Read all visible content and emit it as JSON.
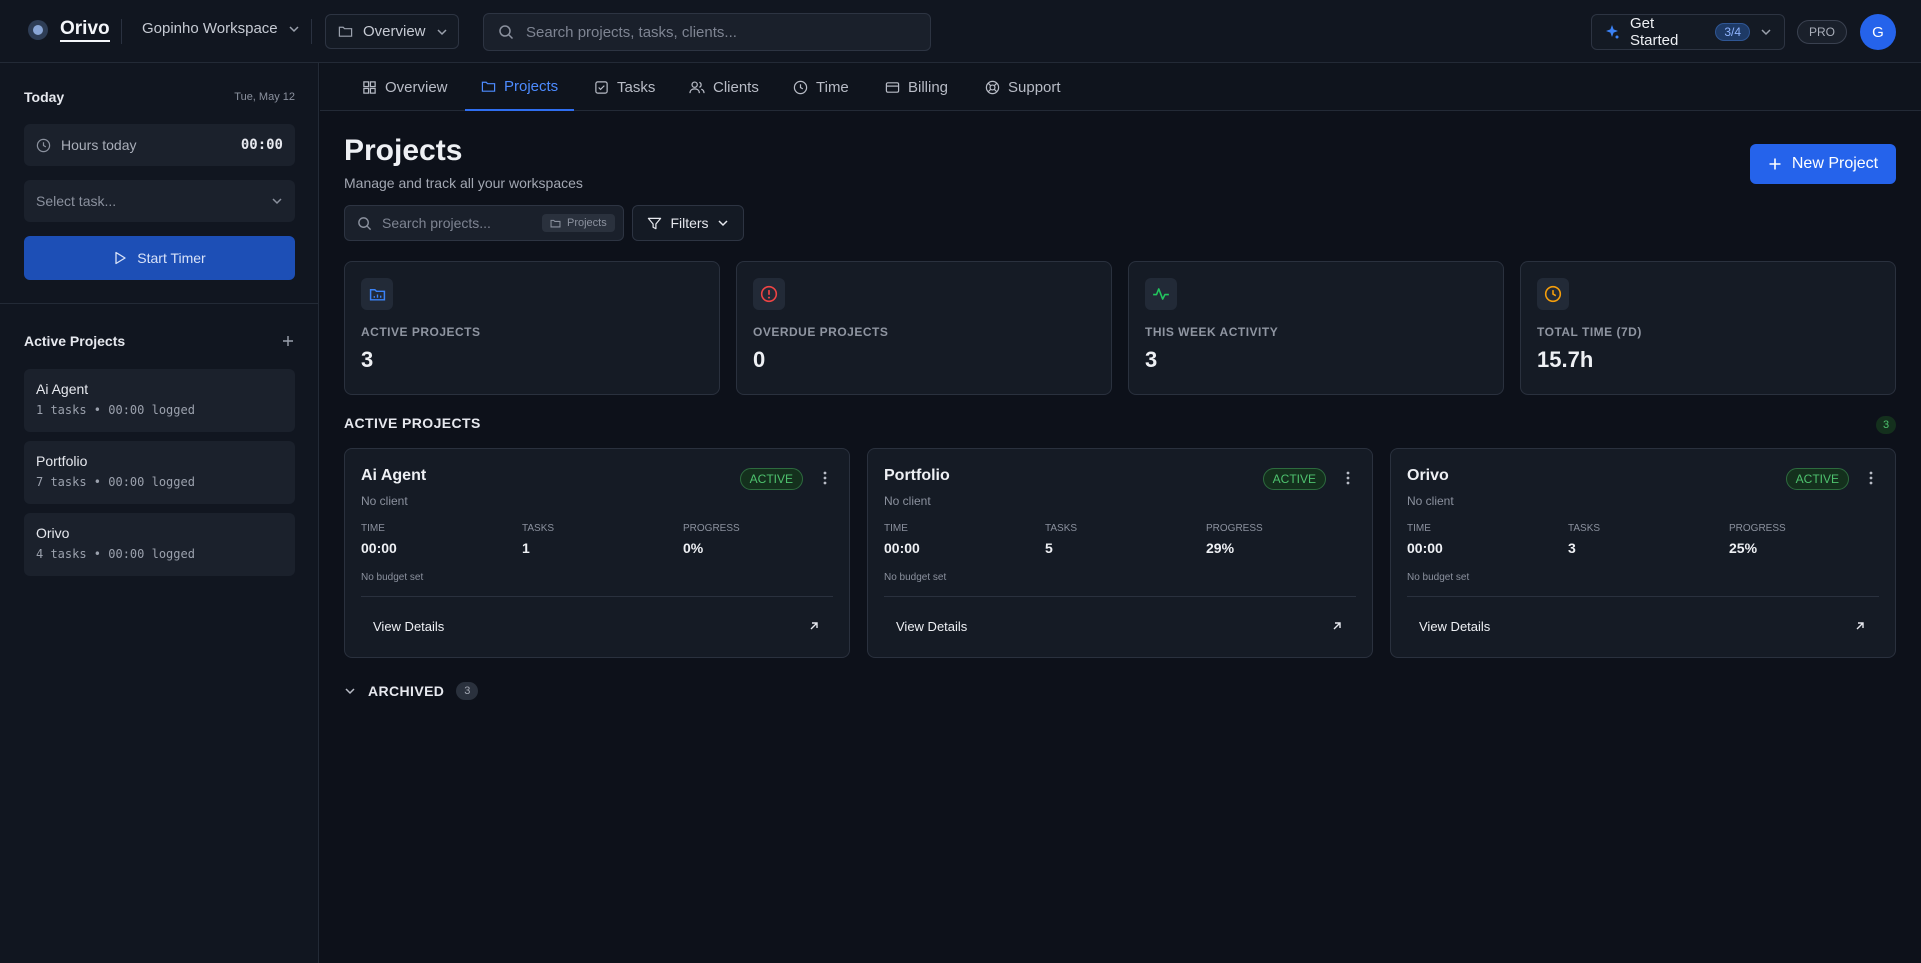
{
  "app": {
    "name": "Orivo",
    "workspace": "Gopinho Workspace",
    "view": "Overview"
  },
  "search": {
    "placeholder": "Search projects, tasks, clients..."
  },
  "get_started": {
    "label": "Get Started",
    "progress": "3/4"
  },
  "plan": "PRO",
  "user": {
    "initial": "G"
  },
  "sidebar": {
    "today": {
      "title": "Today",
      "date": "Tue, May 12"
    },
    "hours": {
      "label": "Hours today",
      "value": "00:00"
    },
    "task_select": {
      "placeholder": "Select task..."
    },
    "start_timer": "Start Timer",
    "active_projects": {
      "title": "Active Projects",
      "items": [
        {
          "name": "Ai Agent",
          "meta": "1 tasks • 00:00 logged"
        },
        {
          "name": "Portfolio",
          "meta": "7 tasks • 00:00 logged"
        },
        {
          "name": "Orivo",
          "meta": "4 tasks • 00:00 logged"
        }
      ]
    }
  },
  "tabs": [
    {
      "label": "Overview",
      "icon": "grid-icon",
      "active": false
    },
    {
      "label": "Projects",
      "icon": "folder-icon",
      "active": true
    },
    {
      "label": "Tasks",
      "icon": "checkbox-icon",
      "active": false
    },
    {
      "label": "Clients",
      "icon": "users-icon",
      "active": false
    },
    {
      "label": "Time",
      "icon": "clock-icon",
      "active": false
    },
    {
      "label": "Billing",
      "icon": "card-icon",
      "active": false
    },
    {
      "label": "Support",
      "icon": "lifebuoy-icon",
      "active": false
    }
  ],
  "page": {
    "title": "Projects",
    "subtitle": "Manage and track all your workspaces",
    "new_project": "New Project",
    "project_search": {
      "placeholder": "Search projects...",
      "scope": "Projects"
    },
    "filters": "Filters"
  },
  "stats": [
    {
      "label": "ACTIVE PROJECTS",
      "value": "3",
      "icon": "folder-icon",
      "color": "#3b82f6"
    },
    {
      "label": "OVERDUE PROJECTS",
      "value": "0",
      "icon": "alert-icon",
      "color": "#ef4444"
    },
    {
      "label": "THIS WEEK ACTIVITY",
      "value": "3",
      "icon": "activity-icon",
      "color": "#22c55e"
    },
    {
      "label": "TOTAL TIME (7D)",
      "value": "15.7h",
      "icon": "clock-icon",
      "color": "#f59e0b"
    }
  ],
  "active_section": {
    "title": "ACTIVE PROJECTS",
    "count": "3"
  },
  "labels": {
    "time": "TIME",
    "tasks": "TASKS",
    "progress": "PROGRESS",
    "view_details": "View Details"
  },
  "projects": [
    {
      "name": "Ai Agent",
      "client": "No client",
      "status": "ACTIVE",
      "time": "00:00",
      "tasks": "1",
      "progress": "0%",
      "budget": "No budget set"
    },
    {
      "name": "Portfolio",
      "client": "No client",
      "status": "ACTIVE",
      "time": "00:00",
      "tasks": "5",
      "progress": "29%",
      "budget": "No budget set"
    },
    {
      "name": "Orivo",
      "client": "No client",
      "status": "ACTIVE",
      "time": "00:00",
      "tasks": "3",
      "progress": "25%",
      "budget": "No budget set"
    }
  ],
  "archived": {
    "title": "ARCHIVED",
    "count": "3"
  }
}
